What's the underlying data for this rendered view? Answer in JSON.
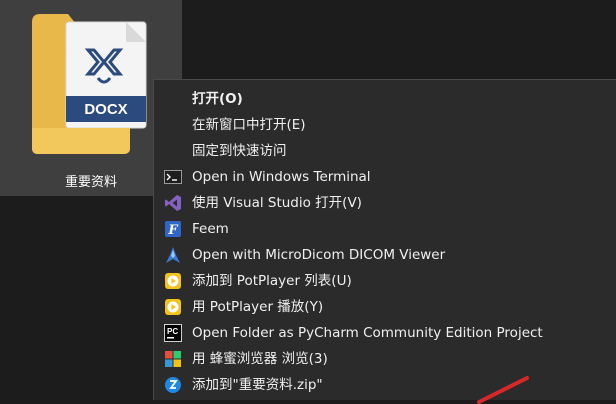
{
  "desktop": {
    "file_icon": {
      "name": "folder-with-docx-icon",
      "badge": "DOCX"
    },
    "file_label": "重要资料"
  },
  "context_menu": {
    "items": [
      {
        "label": "打开(O)",
        "icon": "none",
        "bold": true
      },
      {
        "label": "在新窗口中打开(E)",
        "icon": "none"
      },
      {
        "label": "固定到快速访问",
        "icon": "none"
      },
      {
        "label": "Open in Windows Terminal",
        "icon": "terminal-icon"
      },
      {
        "label": "使用 Visual Studio 打开(V)",
        "icon": "visual-studio-icon"
      },
      {
        "label": "Feem",
        "icon": "feem-icon"
      },
      {
        "label": "Open with MicroDicom DICOM Viewer",
        "icon": "microdicom-icon"
      },
      {
        "label": "添加到 PotPlayer 列表(U)",
        "icon": "potplayer-icon"
      },
      {
        "label": "用 PotPlayer 播放(Y)",
        "icon": "potplayer-icon"
      },
      {
        "label": "Open Folder as PyCharm Community Edition Project",
        "icon": "pycharm-icon"
      },
      {
        "label": "用 蜂蜜浏览器 浏览(3)",
        "icon": "honey-browser-icon"
      },
      {
        "label": "添加到\"重要资料.zip\"",
        "icon": "zip-archive-icon"
      }
    ]
  },
  "colors": {
    "menu_bg": "#2b2b2b",
    "tile_bg": "#3f3f3f",
    "desktop_bg": "#1c1c1c",
    "text": "#f0f0f0",
    "docx_blue": "#2b4a7e"
  }
}
